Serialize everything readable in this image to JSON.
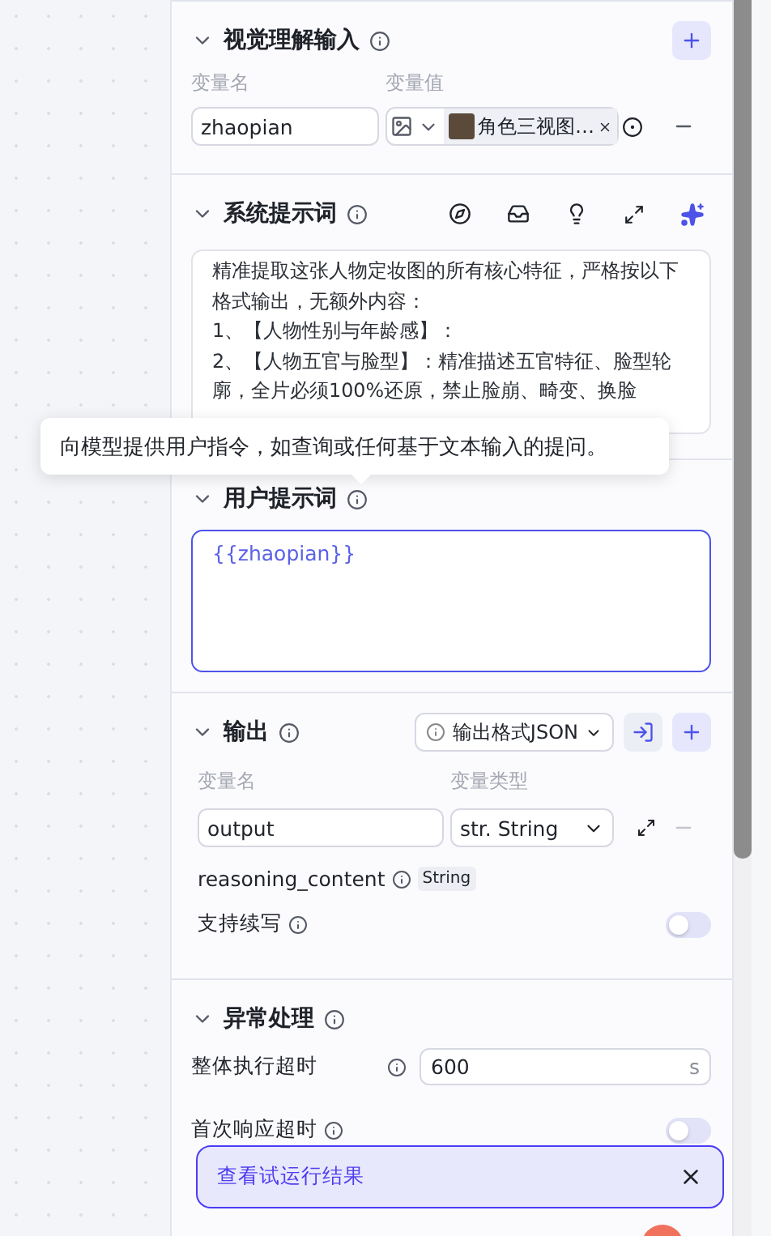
{
  "vision_input": {
    "title": "视觉理解输入",
    "name_label": "变量名",
    "value_label": "变量值",
    "variable": {
      "name": "zhaopian",
      "file": "角色三视图…"
    }
  },
  "system_prompt": {
    "title": "系统提示词",
    "paragraphs": [
      "精准提取这张人物定妆图的所有核心特征，严格按以下格式输出，无额外内容：",
      "1、【人物性别与年龄感】：",
      "2、【人物五官与脸型】：精准描述五官特征、脸型轮廓，全片必须100%还原，禁止脸崩、畸变、换脸"
    ]
  },
  "tooltip": {
    "text": "向模型提供用户指令，如查询或任何基于文本输入的提问。"
  },
  "user_prompt": {
    "title": "用户提示词",
    "value": "{{zhaopian}}"
  },
  "output": {
    "title": "输出",
    "format": "输出格式JSON",
    "name_label": "变量名",
    "type_label": "变量类型",
    "variable": {
      "name": "output",
      "type": "str. String"
    },
    "reasoning": {
      "name": "reasoning_content",
      "type": "String"
    },
    "continue_label": "支持续写",
    "continue_on": false
  },
  "error_handling": {
    "title": "异常处理",
    "timeout_label": "整体执行超时",
    "timeout_value": "600",
    "unit": "s",
    "first_response_label": "首次响应超时",
    "first_response_on": false
  },
  "toast": {
    "text": "查看试运行结果"
  }
}
